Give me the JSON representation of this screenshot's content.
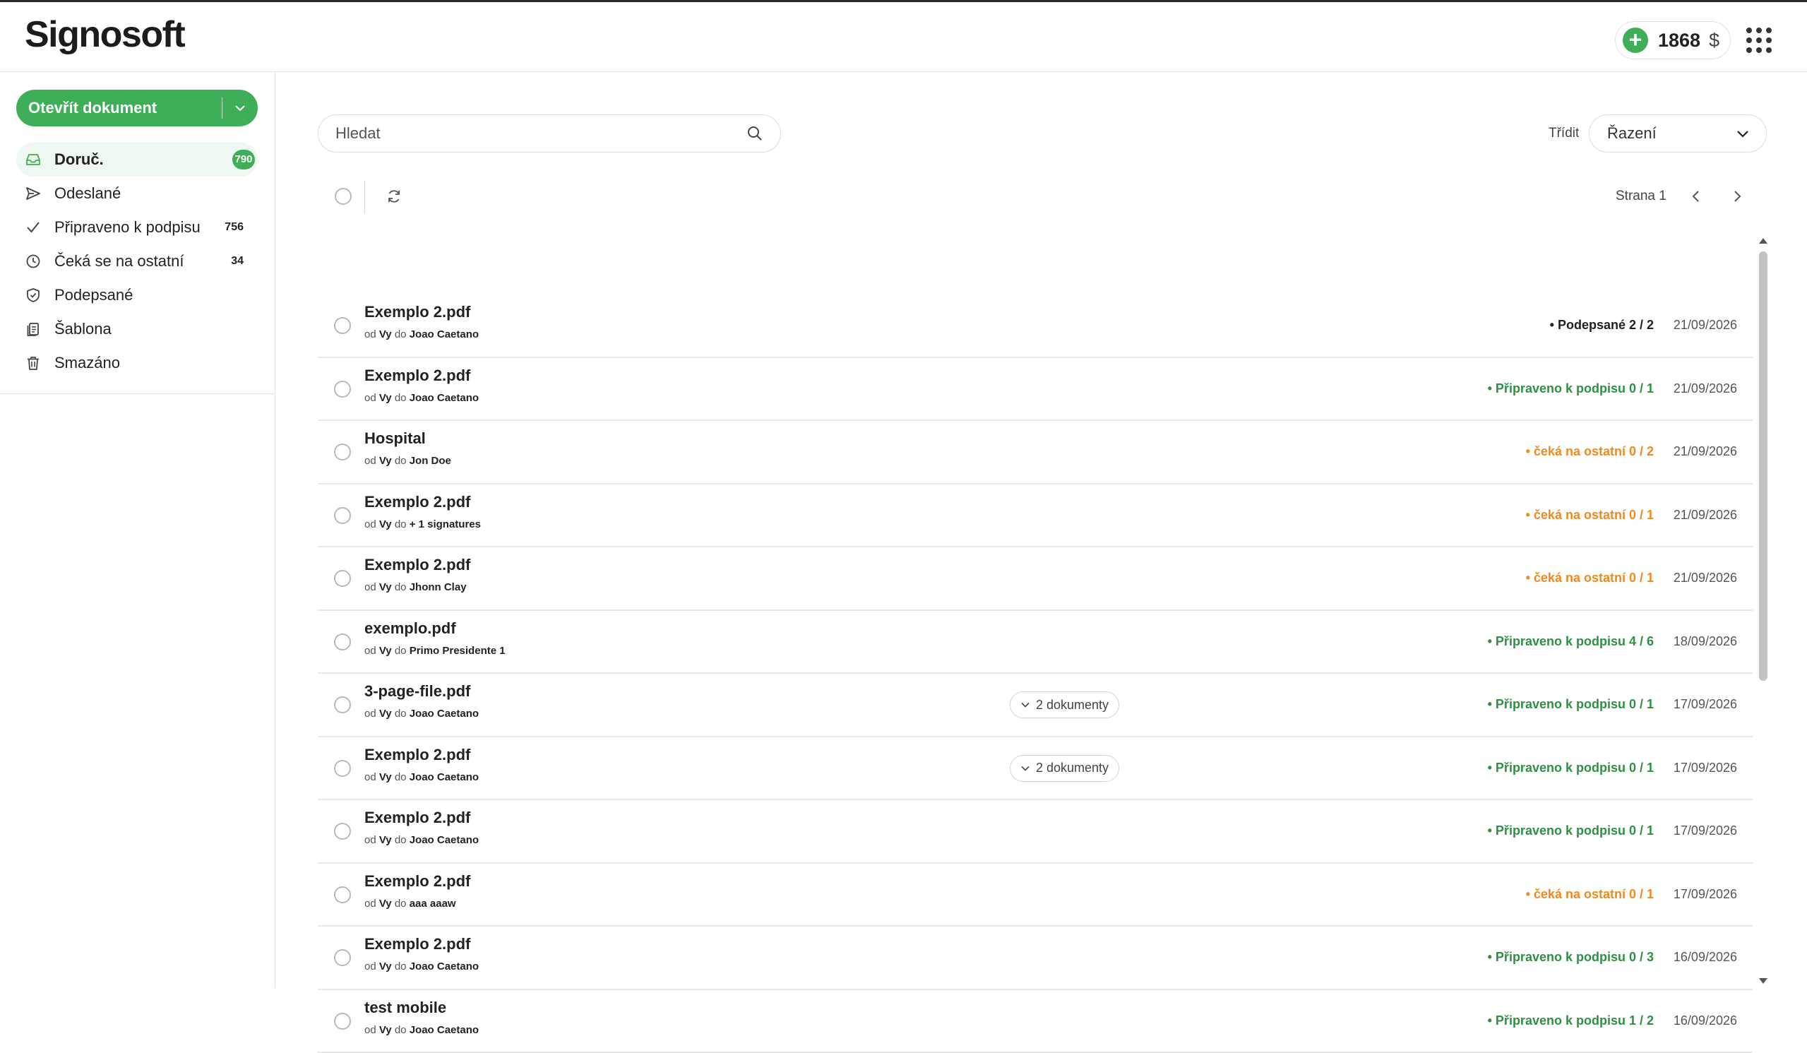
{
  "header": {
    "logo": "Signosoft",
    "credits": "1868",
    "currency": "$"
  },
  "sidebar": {
    "open_button": "Otevřít dokument",
    "items": [
      {
        "label": "Doruč.",
        "count": "790",
        "icon": "inbox-icon",
        "active": true
      },
      {
        "label": "Odeslané",
        "count": "",
        "icon": "send-icon"
      },
      {
        "label": "Připraveno k podpisu",
        "count": "756",
        "icon": "check-icon"
      },
      {
        "label": "Čeká se na ostatní",
        "count": "34",
        "icon": "clock-icon"
      },
      {
        "label": "Podepsané",
        "count": "",
        "icon": "shield-icon"
      },
      {
        "label": "Šablona",
        "count": "",
        "icon": "template-icon"
      },
      {
        "label": "Smazáno",
        "count": "",
        "icon": "trash-icon"
      }
    ]
  },
  "toolbar": {
    "search_placeholder": "Hledat",
    "sort_label": "Třídit",
    "sort_value": "Řazení",
    "page_label": "Strana 1"
  },
  "documents": [
    {
      "title": "Exemplo 2.pdf",
      "from_prefix": "od",
      "from": "Vy",
      "to_prefix": "do",
      "to": "Joao Caetano",
      "status": "• Podepsané 2 / 2",
      "status_color": "black",
      "date": "21/09/2026",
      "docs": ""
    },
    {
      "title": "Exemplo 2.pdf",
      "from_prefix": "od",
      "from": "Vy",
      "to_prefix": "do",
      "to": "Joao Caetano",
      "status": "• Připraveno k podpisu 0 / 1",
      "status_color": "green",
      "date": "21/09/2026",
      "docs": ""
    },
    {
      "title": "Hospital",
      "from_prefix": "od",
      "from": "Vy",
      "to_prefix": "do",
      "to": "Jon Doe",
      "status": "• čeká na ostatní 0 / 2",
      "status_color": "orange",
      "date": "21/09/2026",
      "docs": ""
    },
    {
      "title": "Exemplo 2.pdf",
      "from_prefix": "od",
      "from": "Vy",
      "to_prefix": "do",
      "to": "+ 1 signatures",
      "status": "• čeká na ostatní 0 / 1",
      "status_color": "orange",
      "date": "21/09/2026",
      "docs": ""
    },
    {
      "title": "Exemplo 2.pdf",
      "from_prefix": "od",
      "from": "Vy",
      "to_prefix": "do",
      "to": "Jhonn Clay",
      "status": "• čeká na ostatní 0 / 1",
      "status_color": "orange",
      "date": "21/09/2026",
      "docs": ""
    },
    {
      "title": "exemplo.pdf",
      "from_prefix": "od",
      "from": "Vy",
      "to_prefix": "do",
      "to": "Primo Presidente 1",
      "status": "• Připraveno k podpisu 4 / 6",
      "status_color": "green",
      "date": "18/09/2026",
      "docs": ""
    },
    {
      "title": "3-page-file.pdf",
      "from_prefix": "od",
      "from": "Vy",
      "to_prefix": "do",
      "to": "Joao Caetano",
      "status": "• Připraveno k podpisu 0 / 1",
      "status_color": "green",
      "date": "17/09/2026",
      "docs": "2 dokumenty"
    },
    {
      "title": "Exemplo 2.pdf",
      "from_prefix": "od",
      "from": "Vy",
      "to_prefix": "do",
      "to": "Joao Caetano",
      "status": "• Připraveno k podpisu 0 / 1",
      "status_color": "green",
      "date": "17/09/2026",
      "docs": "2 dokumenty"
    },
    {
      "title": "Exemplo 2.pdf",
      "from_prefix": "od",
      "from": "Vy",
      "to_prefix": "do",
      "to": "Joao Caetano",
      "status": "• Připraveno k podpisu 0 / 1",
      "status_color": "green",
      "date": "17/09/2026",
      "docs": ""
    },
    {
      "title": "Exemplo 2.pdf",
      "from_prefix": "od",
      "from": "Vy",
      "to_prefix": "do",
      "to": "aaa aaaw",
      "status": "• čeká na ostatní 0 / 1",
      "status_color": "orange",
      "date": "17/09/2026",
      "docs": ""
    },
    {
      "title": "Exemplo 2.pdf",
      "from_prefix": "od",
      "from": "Vy",
      "to_prefix": "do",
      "to": "Joao Caetano",
      "status": "• Připraveno k podpisu 0 / 3",
      "status_color": "green",
      "date": "16/09/2026",
      "docs": ""
    },
    {
      "title": "test mobile",
      "from_prefix": "od",
      "from": "Vy",
      "to_prefix": "do",
      "to": "Joao Caetano",
      "status": "• Připraveno k podpisu 1 / 2",
      "status_color": "green",
      "date": "16/09/2026",
      "docs": ""
    }
  ],
  "colors": {
    "accent": "#3fae58",
    "status_green": "#2f8f44",
    "status_orange": "#f08a1c"
  }
}
